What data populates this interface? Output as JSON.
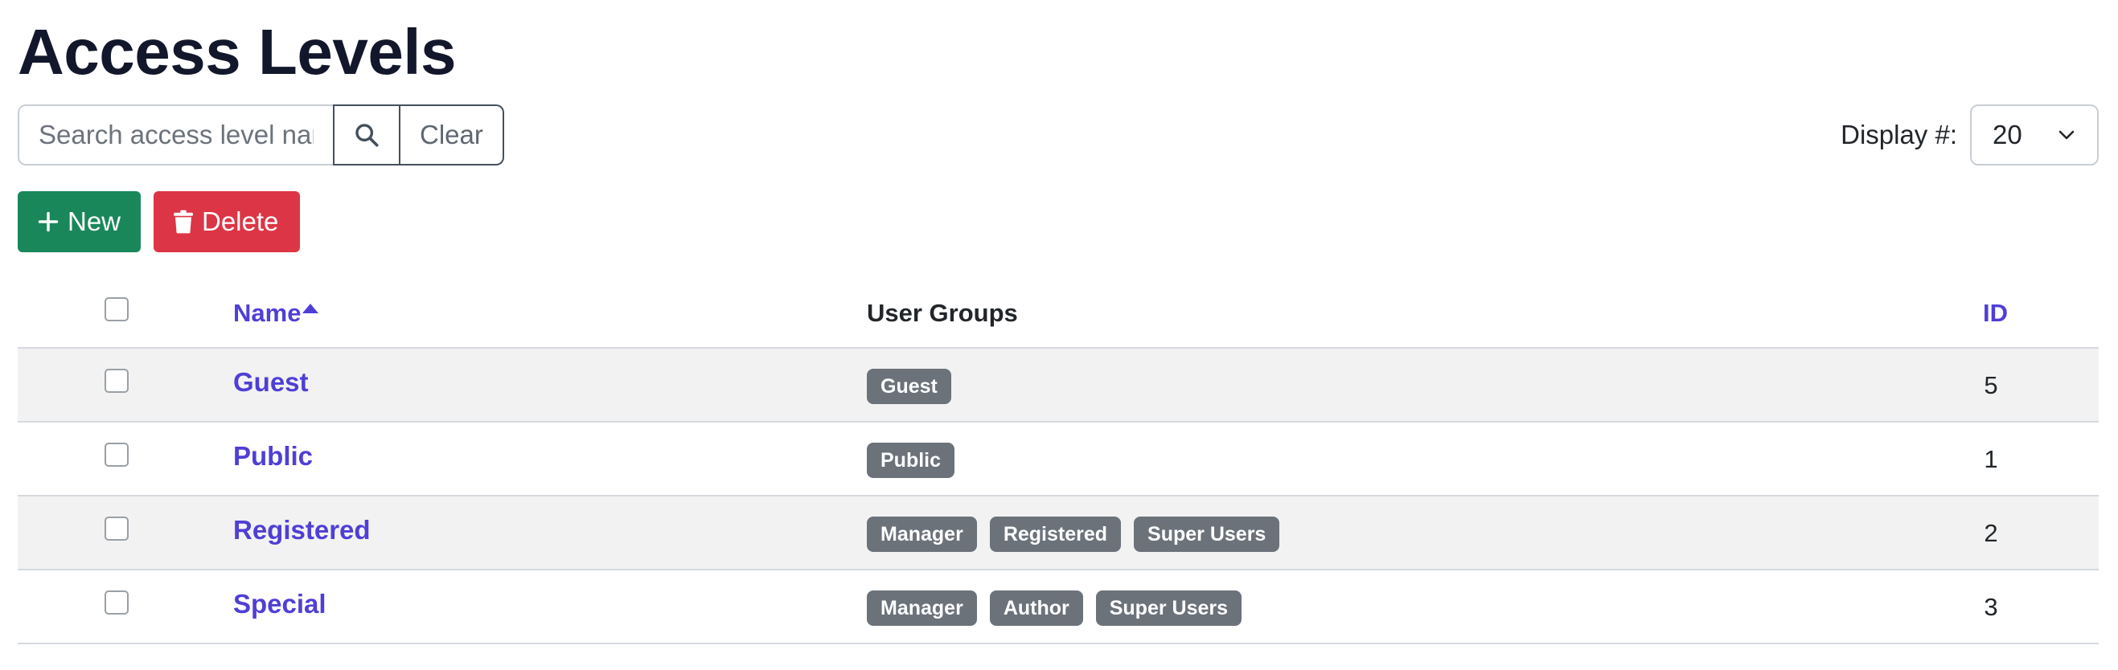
{
  "page": {
    "title": "Access Levels"
  },
  "search": {
    "placeholder": "Search access level name",
    "value": "",
    "search_icon": "search-icon",
    "clear_label": "Clear"
  },
  "display": {
    "label": "Display #:",
    "selected": "20",
    "icon": "chevron-down-icon"
  },
  "toolbar": {
    "new_label": "New",
    "new_icon": "plus-icon",
    "delete_label": "Delete",
    "delete_icon": "trash-icon",
    "colors": {
      "new": "#19875a",
      "delete": "#dc3545"
    }
  },
  "table": {
    "columns": {
      "name": "Name",
      "user_groups": "User Groups",
      "id": "ID"
    },
    "sort": {
      "column": "Name",
      "direction": "ascending"
    },
    "rows": [
      {
        "name": "Guest",
        "groups": [
          "Guest"
        ],
        "id": "5"
      },
      {
        "name": "Public",
        "groups": [
          "Public"
        ],
        "id": "1"
      },
      {
        "name": "Registered",
        "groups": [
          "Manager",
          "Registered",
          "Super Users"
        ],
        "id": "2"
      },
      {
        "name": "Special",
        "groups": [
          "Manager",
          "Author",
          "Super Users"
        ],
        "id": "3"
      }
    ]
  },
  "colors": {
    "link": "#4f3fd6",
    "badge": "#6b727a",
    "stripe": "#f2f2f2"
  }
}
